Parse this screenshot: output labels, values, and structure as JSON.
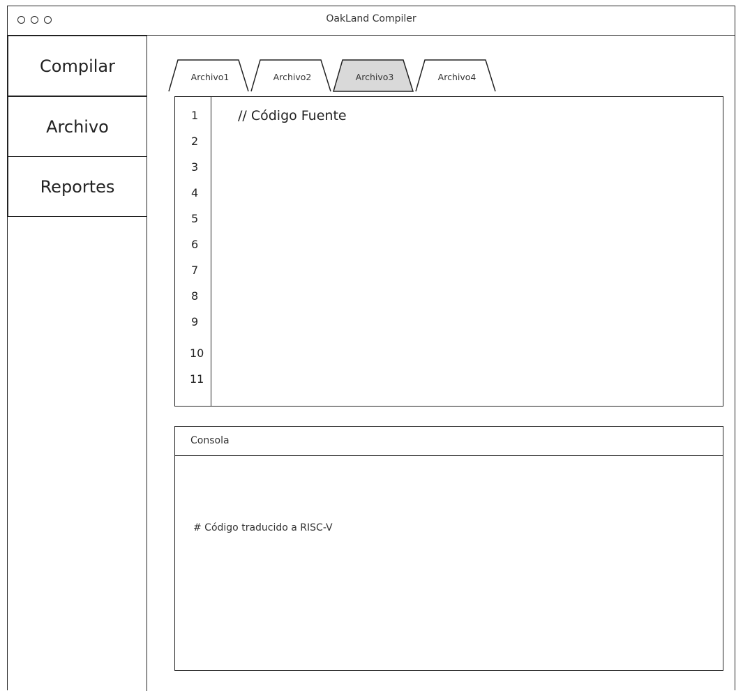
{
  "window": {
    "title": "OakLand Compiler"
  },
  "sidebar": {
    "items": [
      {
        "label": "Compilar"
      },
      {
        "label": "Archivo"
      },
      {
        "label": "Reportes"
      }
    ]
  },
  "tabs": [
    {
      "label": "Archivo1",
      "active": false
    },
    {
      "label": "Archivo2",
      "active": false
    },
    {
      "label": "Archivo3",
      "active": true
    },
    {
      "label": "Archivo4",
      "active": false
    }
  ],
  "editor": {
    "line_numbers": [
      "1",
      "2",
      "3",
      "4",
      "5",
      "6",
      "7",
      "8",
      "9",
      "10",
      "11"
    ],
    "content": "// Código Fuente"
  },
  "console": {
    "title": "Consola",
    "output": "# Código traducido a RISC-V"
  },
  "colors": {
    "active_tab": "#d9d9d9",
    "stroke": "#222222"
  }
}
